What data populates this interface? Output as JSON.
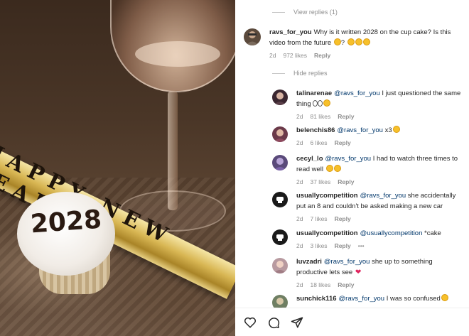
{
  "media": {
    "banner_text": "HAPPY NEW YEAR",
    "cupcake_text": "2028"
  },
  "comments": {
    "view_replies": "View replies (1)",
    "hide_replies": "Hide replies",
    "items": [
      {
        "user": "ravs_for_you",
        "text": "Why is it written 2028 on the cup cake? Is this video from the future ",
        "emoji": [
          "surprised-emoji",
          "laughing-emoji",
          "laughing-emoji",
          "laughing-emoji"
        ],
        "emoji_sep": "? ",
        "time": "2d",
        "likes": "972 likes",
        "reply": "Reply",
        "avatar_color": "#5b4a3c"
      },
      {
        "user": "talinarenae",
        "mention": "@ravs_for_you",
        "text": " I just questioned the same thing ",
        "emoji": [
          "eyes-emoji",
          "grinning-emoji"
        ],
        "time": "2d",
        "likes": "81 likes",
        "reply": "Reply",
        "avatar_color": "#3a2630"
      },
      {
        "user": "belenchis86",
        "mention": "@ravs_for_you",
        "text": " x3",
        "emoji": [
          "surprised-emoji"
        ],
        "time": "2d",
        "likes": "6 likes",
        "reply": "Reply",
        "avatar_color": "#6b3a4a"
      },
      {
        "user": "cecyl_lo",
        "mention": "@ravs_for_you",
        "text": " I had to watch three times to read well ",
        "emoji": [
          "grinning-emoji",
          "laughing-emoji"
        ],
        "time": "2d",
        "likes": "37 likes",
        "reply": "Reply",
        "avatar_color": "#5a4a7a"
      },
      {
        "user": "usuallycompetition",
        "mention": "@ravs_for_you",
        "text": " she accidentally put an 8 and couldn't be asked making a new car",
        "time": "2d",
        "likes": "7 likes",
        "reply": "Reply",
        "avatar_color": "#1a1a1a"
      },
      {
        "user": "usuallycompetition",
        "mention": "@usuallycompetition",
        "text": " *cake",
        "time": "2d",
        "likes": "3 likes",
        "reply": "Reply",
        "more": "•••",
        "avatar_color": "#1a1a1a"
      },
      {
        "user": "luvzadri",
        "mention": "@ravs_for_you",
        "text": " she up to something productive lets see ",
        "emoji": [
          "heart-emoji"
        ],
        "time": "2d",
        "likes": "18 likes",
        "reply": "Reply",
        "avatar_color": "#b89aa0"
      },
      {
        "user": "sunchick116",
        "mention": "@ravs_for_you",
        "text": " I was so confused",
        "emoji": [
          "laughing-emoji"
        ],
        "avatar_color": "#6f7f63"
      }
    ]
  },
  "actions": [
    "heart-icon",
    "comment-icon",
    "share-icon"
  ]
}
